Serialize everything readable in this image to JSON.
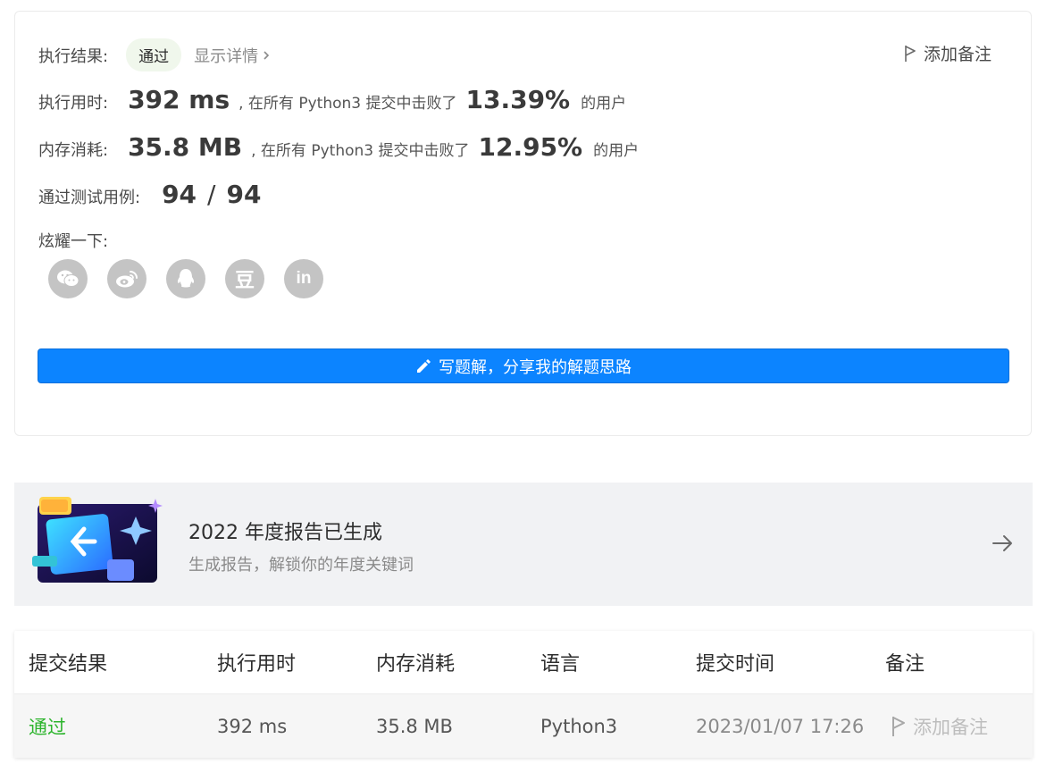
{
  "result": {
    "label": "执行结果:",
    "status": "通过",
    "detail_link": "显示详情",
    "add_note": "添加备注"
  },
  "runtime": {
    "label": "执行用时:",
    "value": "392 ms",
    "text_before": ", 在所有 Python3 提交中击败了",
    "percent": "13.39%",
    "text_after": "的用户"
  },
  "memory": {
    "label": "内存消耗:",
    "value": "35.8 MB",
    "text_before": ", 在所有 Python3 提交中击败了",
    "percent": "12.95%",
    "text_after": "的用户"
  },
  "testcases": {
    "label": "通过测试用例:",
    "passed": "94",
    "separator": "/",
    "total": "94"
  },
  "share": {
    "label": "炫耀一下:",
    "icons": [
      "wechat-icon",
      "weibo-icon",
      "qq-icon",
      "douban-icon",
      "linkedin-icon"
    ],
    "douban_glyph": "豆",
    "linkedin_glyph": "in"
  },
  "write_solution_button": "写题解，分享我的解题思路",
  "banner": {
    "title": "2022 年度报告已生成",
    "subtitle": "生成报告，解锁你的年度关键词"
  },
  "table": {
    "headers": [
      "提交结果",
      "执行用时",
      "内存消耗",
      "语言",
      "提交时间",
      "备注"
    ],
    "row": {
      "result": "通过",
      "runtime": "392 ms",
      "memory": "35.8 MB",
      "language": "Python3",
      "time": "2023/01/07 17:26",
      "note": "添加备注"
    }
  },
  "colors": {
    "primary": "#0c84ff",
    "success": "#2db42d",
    "icon_gray": "#c4c4c4"
  }
}
